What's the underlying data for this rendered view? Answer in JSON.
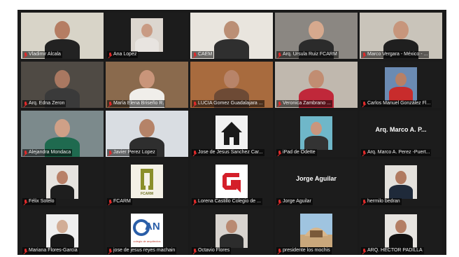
{
  "meeting": {
    "participants": [
      {
        "name": "Vladimir Alcala",
        "bg": "#d8d4c8",
        "skin": "#b57d63",
        "shirt": "#222222",
        "active": true
      },
      {
        "name": "Ana Lopez",
        "bg": "#1c1c1c",
        "skin": "#c99b84",
        "shirt": "#e8e4e0",
        "thumb": "#dcd6cf"
      },
      {
        "name": "CAEM",
        "bg": "#e9e5de",
        "skin": "#bb8f75",
        "shirt": "#2f2f2f"
      },
      {
        "name": "Arq. Ursula Ruiz FCARM",
        "bg": "#8b8782",
        "skin": "#d6a98e",
        "shirt": "#2b2b2b"
      },
      {
        "name": "Marco Vergara - México - ...",
        "bg": "#c9c4ba",
        "skin": "#c7967c",
        "shirt": "#1f1f1f"
      },
      {
        "name": "Arq. Edna Zeron",
        "bg": "#4f4a44",
        "skin": "#a97861",
        "shirt": "#3a3a3a"
      },
      {
        "name": "María Elena Briseño R.",
        "bg": "#8a6a4d",
        "skin": "#c9957a",
        "shirt": "#f0eeea"
      },
      {
        "name": "LUCIA Gomez Guadalajara ...",
        "bg": "#a86b3e",
        "skin": "#b88469",
        "shirt": "#6d4a35"
      },
      {
        "name": "Veronica Zambrano ...",
        "bg": "#c0b8ae",
        "skin": "#c18d72",
        "shirt": "#c0283a"
      },
      {
        "name": "Carlos Manuel González Fl...",
        "bg": "#1c1c1c",
        "skin": "#b88065",
        "shirt": "#c82c2c",
        "thumb": "#6b8bb3"
      },
      {
        "name": "Alejandra Mondaca",
        "bg": "#7c8a8c",
        "skin": "#cfa087",
        "shirt": "#1f6a4f"
      },
      {
        "name": "Javier Perez Lopez",
        "bg": "#d9dde2",
        "skin": "#b58368",
        "shirt": "#2e2e2e"
      },
      {
        "name": "Jose de Jesus Sanchez Car...",
        "bg": "#1c1c1c",
        "logo": "house"
      },
      {
        "name": "iPad de Odette",
        "bg": "#1c1c1c",
        "skin": "#c9967e",
        "shirt": "#333333",
        "thumb": "#6fb7c9"
      },
      {
        "name": "Arq. Marco A. Perez -Puert...",
        "bg": "#1c1c1c",
        "label": "Arq. Marco A. P..."
      },
      {
        "name": "Félix Sotelo",
        "bg": "#1c1c1c",
        "skin": "#b88068",
        "shirt": "#1e1e1e",
        "thumb": "#e6e3df"
      },
      {
        "name": "FCARM",
        "bg": "#1c1c1c",
        "logo": "fcarm"
      },
      {
        "name": "Lorena Castillo Colegio de ...",
        "bg": "#1c1c1c",
        "logo": "cq"
      },
      {
        "name": "Jorge Aguilar",
        "bg": "#1c1c1c",
        "label": "Jorge Aguilar"
      },
      {
        "name": "hermilo bedran",
        "bg": "#1c1c1c",
        "skin": "#b07a60",
        "shirt": "#1f2a3a",
        "thumb": "#e4e1dc"
      },
      {
        "name": "Mariana Flores-Garcia",
        "bg": "#1c1c1c",
        "skin": "#d2ad96",
        "shirt": "#1a1a1a",
        "thumb": "#efefef"
      },
      {
        "name": "jose de jesus reyes machain",
        "bg": "#1c1c1c",
        "logo": "can"
      },
      {
        "name": "Octavio Flores",
        "bg": "#1c1c1c",
        "skin": "#b98a72",
        "shirt": "#2c2c2c",
        "thumb": "#d8d4cf"
      },
      {
        "name": "presidente los mochis",
        "bg": "#1c1c1c",
        "logo": "building"
      },
      {
        "name": "ARQ. HECTOR PADILLA",
        "bg": "#1c1c1c",
        "skin": "#b47e64",
        "shirt": "#111111",
        "thumb": "#e7e4e0"
      }
    ],
    "logo_texts": {
      "fcarm": "FCARM",
      "can": "AN",
      "can_sub": "colegio de arquitectos"
    }
  }
}
